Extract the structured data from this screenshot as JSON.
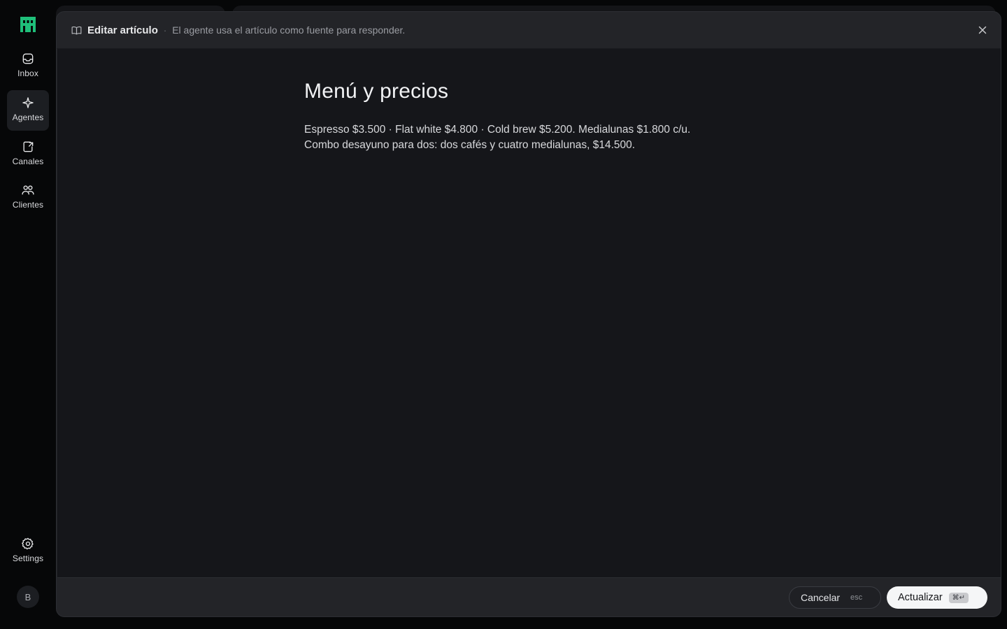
{
  "sidebar": {
    "items": [
      {
        "label": "Inbox",
        "icon": "inbox-icon"
      },
      {
        "label": "Agentes",
        "icon": "sparkle-icon",
        "active": true
      },
      {
        "label": "Canales",
        "icon": "channel-icon"
      },
      {
        "label": "Clientes",
        "icon": "users-icon"
      }
    ],
    "settings_label": "Settings",
    "avatar_initial": "B"
  },
  "modal": {
    "title": "Editar artículo",
    "separator": "·",
    "subtitle": "El agente usa el artículo como fuente para responder."
  },
  "article": {
    "title": "Menú y precios",
    "body": "Espresso $3.500 · Flat white $4.800 · Cold brew $5.200. Medialunas $1.800 c/u.\nCombo desayuno para dos: dos cafés y cuatro medialunas, $14.500."
  },
  "footer": {
    "cancel_label": "Cancelar",
    "cancel_shortcut": "esc",
    "update_label": "Actualizar",
    "update_shortcut": "⌘↵"
  },
  "colors": {
    "brand": "#1fbf7a",
    "background": "#060708",
    "modal": "#232428",
    "editor": "#15161a"
  }
}
